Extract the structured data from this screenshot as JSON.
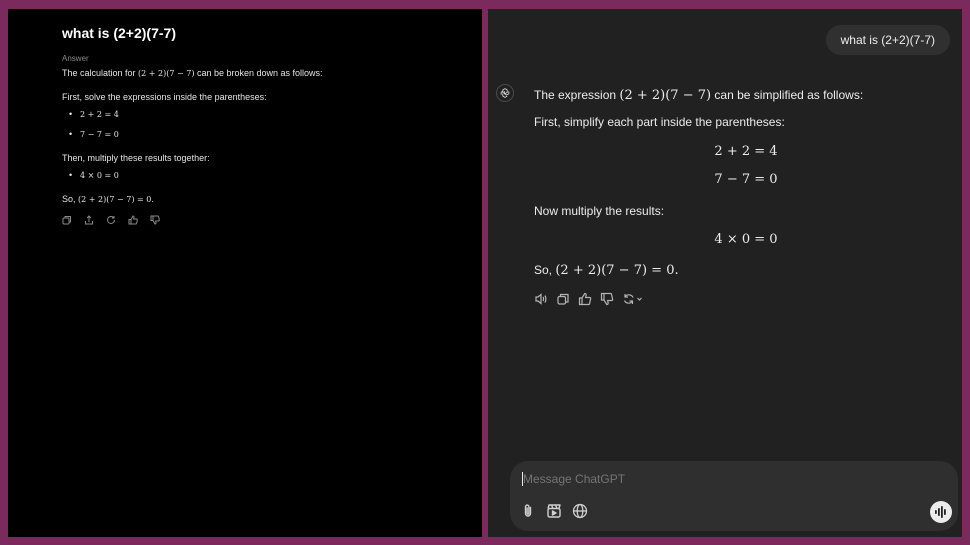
{
  "left": {
    "title": "what is (2+2)(7-7)",
    "answer_label": "Answer",
    "intro_prefix": "The calculation for ",
    "intro_math": "(2 + 2)(7 − 7)",
    "intro_suffix": " can be broken down as follows:",
    "step1": "First, solve the expressions inside the parentheses:",
    "bullets1": [
      "2 + 2 = 4",
      "7 − 7 = 0"
    ],
    "step2": "Then, multiply these results together:",
    "bullets2": [
      "4 × 0 = 0"
    ],
    "conclusion_prefix": "So, ",
    "conclusion_math": "(2 + 2)(7 − 7) = 0",
    "conclusion_suffix": ".",
    "action_icons": [
      "copy-icon",
      "share-icon",
      "regenerate-icon",
      "thumbs-up-icon",
      "thumbs-down-icon"
    ]
  },
  "right": {
    "user_message": "what is (2+2)(7-7)",
    "intro_prefix": "The expression ",
    "intro_math": "(2 + 2)(7 − 7)",
    "intro_suffix": " can be simplified as follows:",
    "step1": "First, simplify each part inside the parentheses:",
    "display1": "2 + 2 = 4",
    "display2": "7 − 7 = 0",
    "step2": "Now multiply the results:",
    "display3": "4 × 0 = 0",
    "conclusion_prefix": "So, ",
    "conclusion_math": "(2 + 2)(7 − 7) = 0.",
    "action_icons": [
      "read-aloud-icon",
      "copy-icon",
      "thumbs-up-icon",
      "thumbs-down-icon",
      "regenerate-icon",
      "chevron-down-icon"
    ],
    "composer": {
      "placeholder": "Message ChatGPT",
      "tool_icons": [
        "attach-icon",
        "tools-icon",
        "globe-icon"
      ],
      "voice_icon": "voice-mode-icon"
    }
  },
  "colors": {
    "frame": "#7a2a5c",
    "left_bg": "#000000",
    "right_bg": "#212121",
    "bubble_bg": "#303030",
    "composer_bg": "#2f2f2f"
  }
}
